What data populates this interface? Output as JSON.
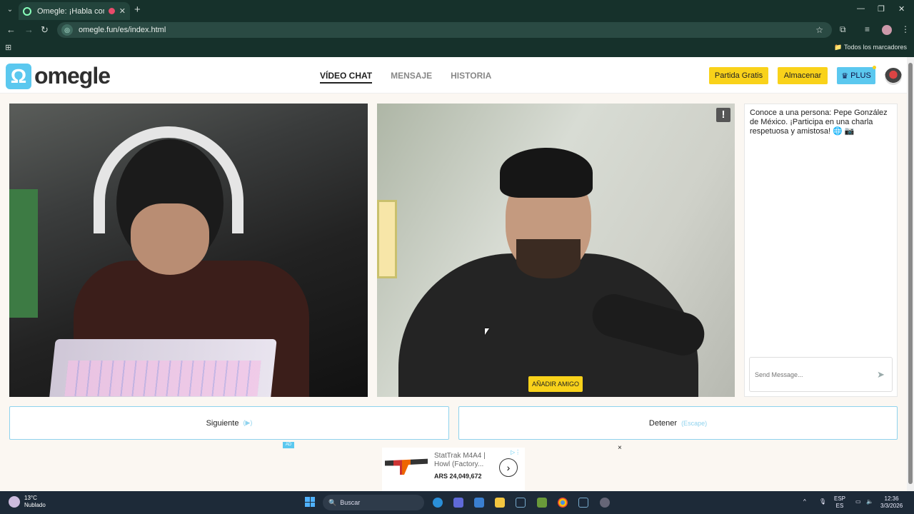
{
  "browser": {
    "tab_title": "Omegle: ¡Habla con Desco",
    "url": "omegle.fun/es/index.html",
    "bookmarks_all": "Todos los marcadores"
  },
  "site": {
    "logo_text": "omegle",
    "nav": [
      {
        "label": "VÍDEO CHAT",
        "active": true
      },
      {
        "label": "MENSAJE"
      },
      {
        "label": "HISTORIA"
      }
    ],
    "buttons": {
      "free_match": "Partida Gratis",
      "store": "Almacenar",
      "plus": "PLUS"
    }
  },
  "video": {
    "report_glyph": "!",
    "add_friend": "AÑADIR AMIGO"
  },
  "chat": {
    "message": "Conoce a una persona: Pepe González de México. ¡Participa en una charla respetuosa y amistosa! 🌐 📷",
    "placeholder": "Send Message..."
  },
  "controls": {
    "next_label": "Siguiente",
    "next_hint": "(▶)",
    "stop_label": "Detener",
    "stop_hint": "(Escape)"
  },
  "ad": {
    "badge": "AD",
    "title": "StatTrak M4A4 | Howl (Factory...",
    "price": "ARS 24,049,672",
    "close": "×"
  },
  "taskbar": {
    "temp": "13°C",
    "weather": "Nublado",
    "search": "Buscar",
    "lang1": "ESP",
    "lang2": "ES",
    "time": "12:36",
    "date": "3/3/2026"
  },
  "colors": {
    "accent_yellow": "#f9d21a",
    "accent_blue": "#5bc8ef",
    "browser_frame": "#16312b"
  }
}
